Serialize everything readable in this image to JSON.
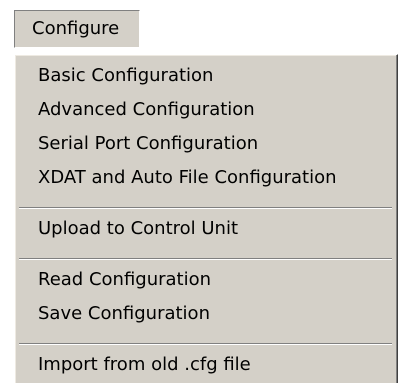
{
  "menubar": {
    "title": "Configure"
  },
  "menu": {
    "groups": [
      [
        "Basic Configuration",
        "Advanced Configuration",
        "Serial Port Configuration",
        "XDAT and Auto File Configuration"
      ],
      [
        "Upload to Control Unit"
      ],
      [
        "Read Configuration",
        "Save Configuration"
      ],
      [
        "Import from old .cfg file"
      ]
    ]
  }
}
